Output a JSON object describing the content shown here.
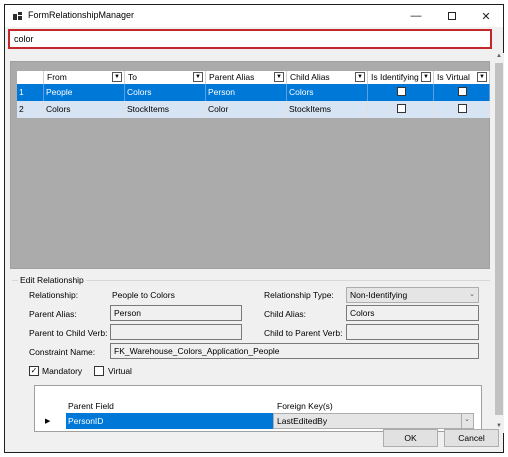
{
  "window": {
    "title": "FormRelationshipManager"
  },
  "filter": {
    "value": "color"
  },
  "grid": {
    "columns": [
      "From",
      "To",
      "Parent Alias",
      "Child Alias",
      "Is Identifying",
      "Is Virtual"
    ],
    "rows": [
      {
        "num": "1",
        "from": "People",
        "to": "Colors",
        "parent_alias": "Person",
        "child_alias": "Colors",
        "is_identifying": false,
        "is_virtual": false
      },
      {
        "num": "2",
        "from": "Colors",
        "to": "StockItems",
        "parent_alias": "Color",
        "child_alias": "StockItems",
        "is_identifying": false,
        "is_virtual": false
      }
    ]
  },
  "edit": {
    "section_title": "Edit Relationship",
    "relationship_label": "Relationship:",
    "relationship_value": "People to Colors",
    "type_label": "Relationship Type:",
    "type_value": "Non-Identifying",
    "parent_alias_label": "Parent Alias:",
    "parent_alias_value": "Person",
    "child_alias_label": "Child Alias:",
    "child_alias_value": "Colors",
    "p2c_label": "Parent to Child Verb:",
    "p2c_value": "",
    "c2p_label": "Child to Parent Verb:",
    "c2p_value": "",
    "constraint_label": "Constraint Name:",
    "constraint_value": "FK_Warehouse_Colors_Application_People",
    "mandatory_label": "Mandatory",
    "mandatory_checked": true,
    "virtual_label": "Virtual",
    "virtual_checked": false
  },
  "fk": {
    "parent_field_header": "Parent Field",
    "foreign_keys_header": "Foreign Key(s)",
    "row": {
      "parent_field": "PersonID",
      "foreign_key": "LastEditedBy"
    }
  },
  "buttons": {
    "ok": "OK",
    "cancel": "Cancel"
  }
}
